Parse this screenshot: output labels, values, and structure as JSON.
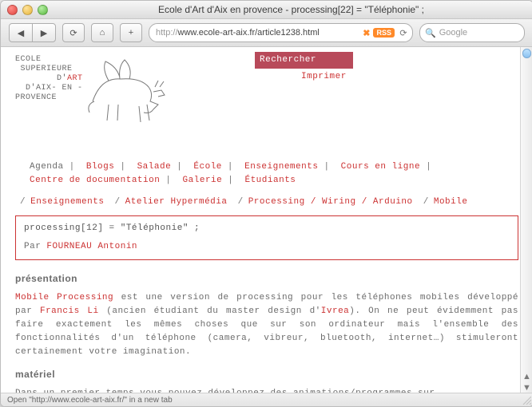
{
  "window": {
    "title": "Ecole d'Art d'Aix en provence - processing[22] = \"Téléphonie\" ;"
  },
  "toolbar": {
    "back_glyph": "◀",
    "fwd_glyph": "▶",
    "reload_glyph": "⟳",
    "home_glyph": "⌂",
    "add_glyph": "+",
    "url_prefix": "http://",
    "url_rest": "www.ecole-art-aix.fr/article1238.html",
    "rss_label": "RSS",
    "snap_glyph": "⟳",
    "search_placeholder": "Google",
    "search_glyph": "🔍"
  },
  "logo": {
    "l1": "ECOLE",
    "l2": " SUPERIEURE",
    "l3": "        D'",
    "l3_art": "ART",
    "l4": "  D'AIX- EN -",
    "l5": "PROVENCE"
  },
  "topright": {
    "search_label": "Rechercher",
    "print_label": "Imprimer"
  },
  "menu": {
    "items": [
      "Agenda",
      "Blogs",
      "Salade",
      "École",
      "Enseignements",
      "Cours en ligne",
      "Centre de documentation",
      "Galerie",
      "Étudiants"
    ]
  },
  "breadcrumb": {
    "items": [
      "Enseignements",
      "Atelier Hypermédia",
      "Processing / Wiring / Arduino",
      "Mobile"
    ]
  },
  "article": {
    "header_code": "processing[12] = \"Téléphonie\" ;",
    "by_prefix": "Par ",
    "author": "FOURNEAU Antonin",
    "section1_title": "présentation",
    "p1_a": "Mobile Processing",
    "p1_b": " est une version de processing pour les téléphones mobiles développé par ",
    "p1_c": "Francis Li",
    "p1_d": " (ancien étudiant du master design d'",
    "p1_e": "Ivrea",
    "p1_f": "). On ne peut évidemment pas faire exactement les mêmes choses que sur son ordinateur mais l'ensemble des fonctionnalités d'un téléphone (camera, vibreur, bluetooth, internet…) stimuleront certainement votre imagination.",
    "section2_title": "matériel",
    "p2": "Dans un premier temps vous pouvez développez des animations/programmes sur"
  },
  "statusbar": {
    "text": "Open \"http://www.ecole-art-aix.fr/\" in a new tab"
  }
}
